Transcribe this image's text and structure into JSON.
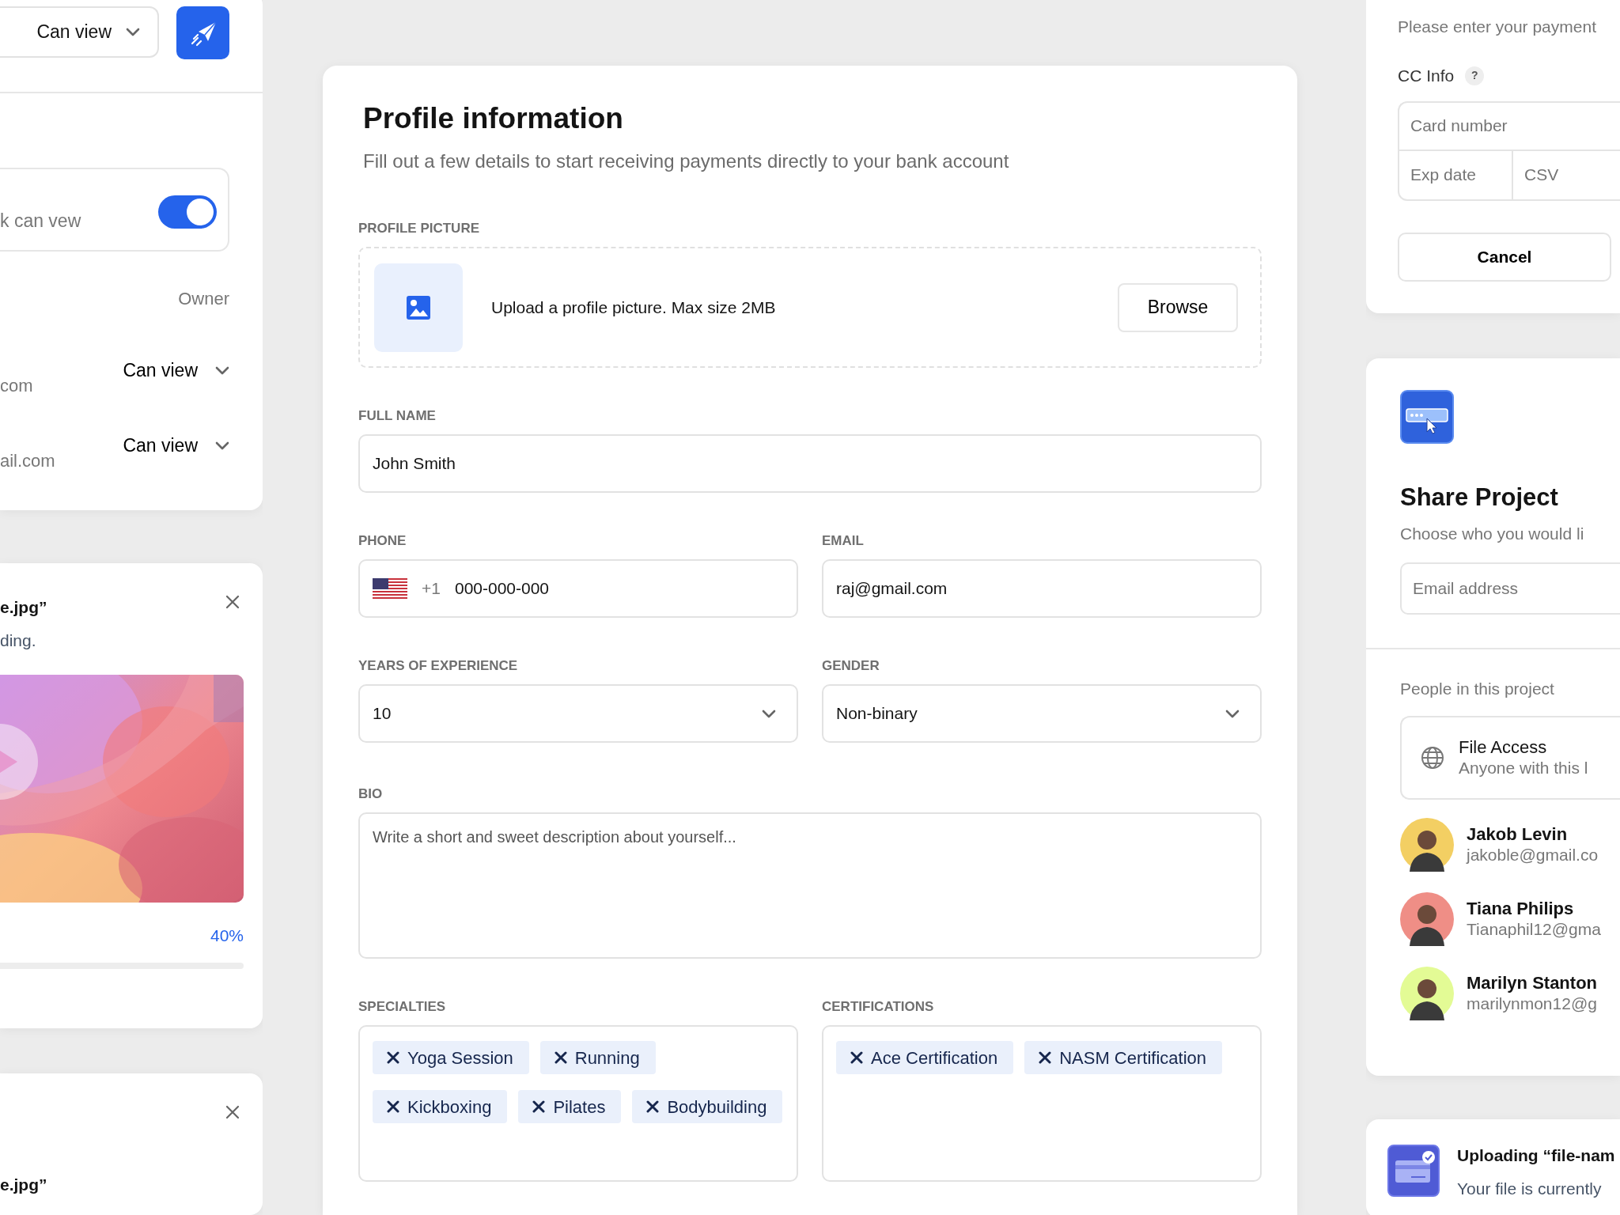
{
  "share_panel": {
    "permission_select": "Can view",
    "link_toggle": {
      "label": "k can vew",
      "on": true
    },
    "owner_label": "Owner",
    "members": [
      {
        "email": "com",
        "permission": "Can view"
      },
      {
        "email": "ail.com",
        "permission": "Can view"
      }
    ]
  },
  "upload_cards": [
    {
      "kind": "video",
      "title": "e.jpg”",
      "subtitle": "ding.",
      "percent": "40%"
    },
    {
      "kind": "plain",
      "title": "e.jpg”"
    }
  ],
  "profile_form": {
    "title": "Profile information",
    "subtitle": "Fill out a few details to start receiving payments directly to your bank account",
    "profile_picture": {
      "label": "PROFILE PICTURE",
      "hint": "Upload a profile picture. Max size 2MB",
      "button": "Browse"
    },
    "full_name": {
      "label": "FULL NAME",
      "value": "John Smith"
    },
    "phone": {
      "label": "PHONE",
      "country_code": "+1",
      "value": "000-000-000"
    },
    "email": {
      "label": "EMAIL",
      "value": "raj@gmail.com"
    },
    "years": {
      "label": "YEARS OF EXPERIENCE",
      "value": "10"
    },
    "gender": {
      "label": "GENDER",
      "value": "Non-binary"
    },
    "bio": {
      "label": "BIO",
      "placeholder": "Write a short and sweet description about yourself..."
    },
    "specialties": {
      "label": "SPECIALTIES",
      "tags": [
        "Yoga Session",
        "Running",
        "Kickboxing",
        "Pilates",
        "Bodybuilding"
      ]
    },
    "certifications": {
      "label": "CERTIFICATIONS",
      "tags": [
        "Ace Certification",
        "NASM Certification"
      ]
    }
  },
  "payment_panel": {
    "subtitle": "Please enter your payment",
    "cc_label": "CC Info",
    "help_mark": "?",
    "card_placeholder": "Card number",
    "exp_placeholder": "Exp date",
    "csv_placeholder": "CSV",
    "button": "Cancel"
  },
  "share_project": {
    "title": "Share Project",
    "subtitle": "Choose who you would li",
    "email_placeholder": "Email address",
    "people_heading": "People in this project",
    "access": {
      "title": "File Access",
      "subtitle": "Anyone with this l"
    },
    "people": [
      {
        "name": "Jakob Levin",
        "email": "jakoble@gmail.co",
        "color": "#f3cf63"
      },
      {
        "name": "Tiana Philips",
        "email": "Tianaphil12@gma",
        "color": "#ef8e86"
      },
      {
        "name": "Marilyn Stanton",
        "email": "marilynmon12@g",
        "color": "#e3fb95"
      }
    ]
  },
  "upload_toast": {
    "title": "Uploading “file-nam",
    "text": "Your file is currently"
  }
}
